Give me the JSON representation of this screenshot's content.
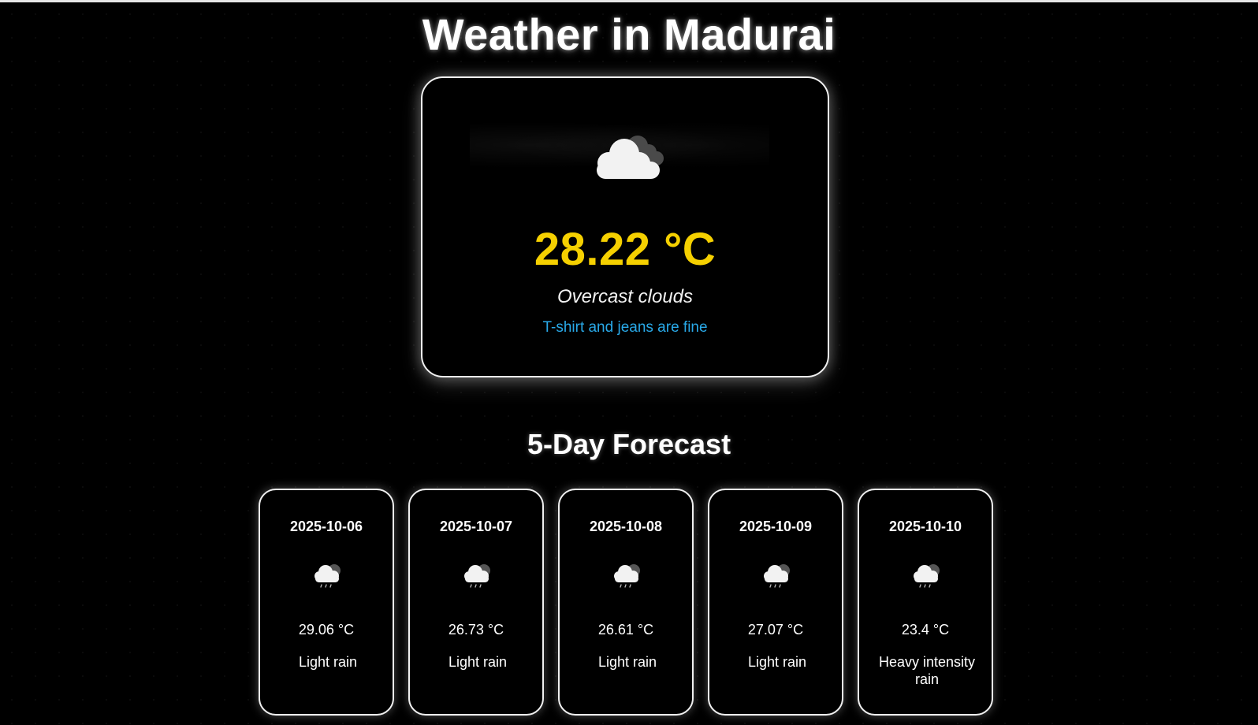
{
  "header": {
    "title": "Weather in Madurai"
  },
  "current": {
    "icon": "overcast-clouds-icon",
    "temperature": "28.22 °C",
    "description": "Overcast clouds",
    "advice": "T-shirt and jeans are fine"
  },
  "forecast": {
    "title": "5-Day Forecast",
    "days": [
      {
        "date": "2025-10-06",
        "icon": "light-rain-icon",
        "temperature": "29.06 °C",
        "description": "Light rain"
      },
      {
        "date": "2025-10-07",
        "icon": "light-rain-icon",
        "temperature": "26.73 °C",
        "description": "Light rain"
      },
      {
        "date": "2025-10-08",
        "icon": "light-rain-icon",
        "temperature": "26.61 °C",
        "description": "Light rain"
      },
      {
        "date": "2025-10-09",
        "icon": "light-rain-icon",
        "temperature": "27.07 °C",
        "description": "Light rain"
      },
      {
        "date": "2025-10-10",
        "icon": "heavy-rain-icon",
        "temperature": "23.4 °C",
        "description": "Heavy intensity rain"
      }
    ]
  },
  "colors": {
    "background": "#000000",
    "temperature": "#f5d000",
    "advice": "#29a9e8",
    "border": "#f0f0f0"
  }
}
